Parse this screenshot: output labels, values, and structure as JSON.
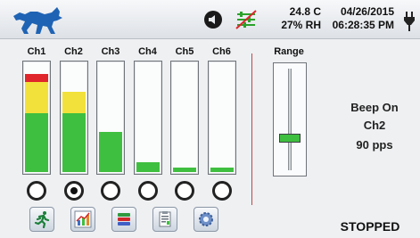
{
  "header": {
    "temperature": "24.8 C",
    "humidity": "27% RH",
    "date": "04/26/2015",
    "time": "06:28:35 PM",
    "icons": [
      "wolf-logo-icon",
      "speaker-icon",
      "muted-equalizer-icon",
      "power-plug-icon"
    ]
  },
  "channels": [
    {
      "label": "Ch1",
      "selected": false,
      "level_green": 0.53,
      "level_yellow": 0.28,
      "level_red": 0.07
    },
    {
      "label": "Ch2",
      "selected": true,
      "level_green": 0.53,
      "level_yellow": 0.19,
      "level_red": 0.0
    },
    {
      "label": "Ch3",
      "selected": false,
      "level_green": 0.36,
      "level_yellow": 0.0,
      "level_red": 0.0
    },
    {
      "label": "Ch4",
      "selected": false,
      "level_green": 0.09,
      "level_yellow": 0.0,
      "level_red": 0.0
    },
    {
      "label": "Ch5",
      "selected": false,
      "level_green": 0.04,
      "level_yellow": 0.0,
      "level_red": 0.0
    },
    {
      "label": "Ch6",
      "selected": false,
      "level_green": 0.04,
      "level_yellow": 0.0,
      "level_red": 0.0
    }
  ],
  "range": {
    "label": "Range",
    "level": 0.3
  },
  "info": {
    "line1": "Beep On",
    "line2": "Ch2",
    "line3": "90 pps"
  },
  "toolbar": [
    "running-man-icon",
    "chart-icon",
    "database-icon",
    "clipboard-icon",
    "settings-gear-icon"
  ],
  "status": "STOPPED",
  "colors": {
    "green": "#3fbf3f",
    "yellow": "#f2e13a",
    "red": "#e0262a",
    "logo": "#1f63b4"
  }
}
